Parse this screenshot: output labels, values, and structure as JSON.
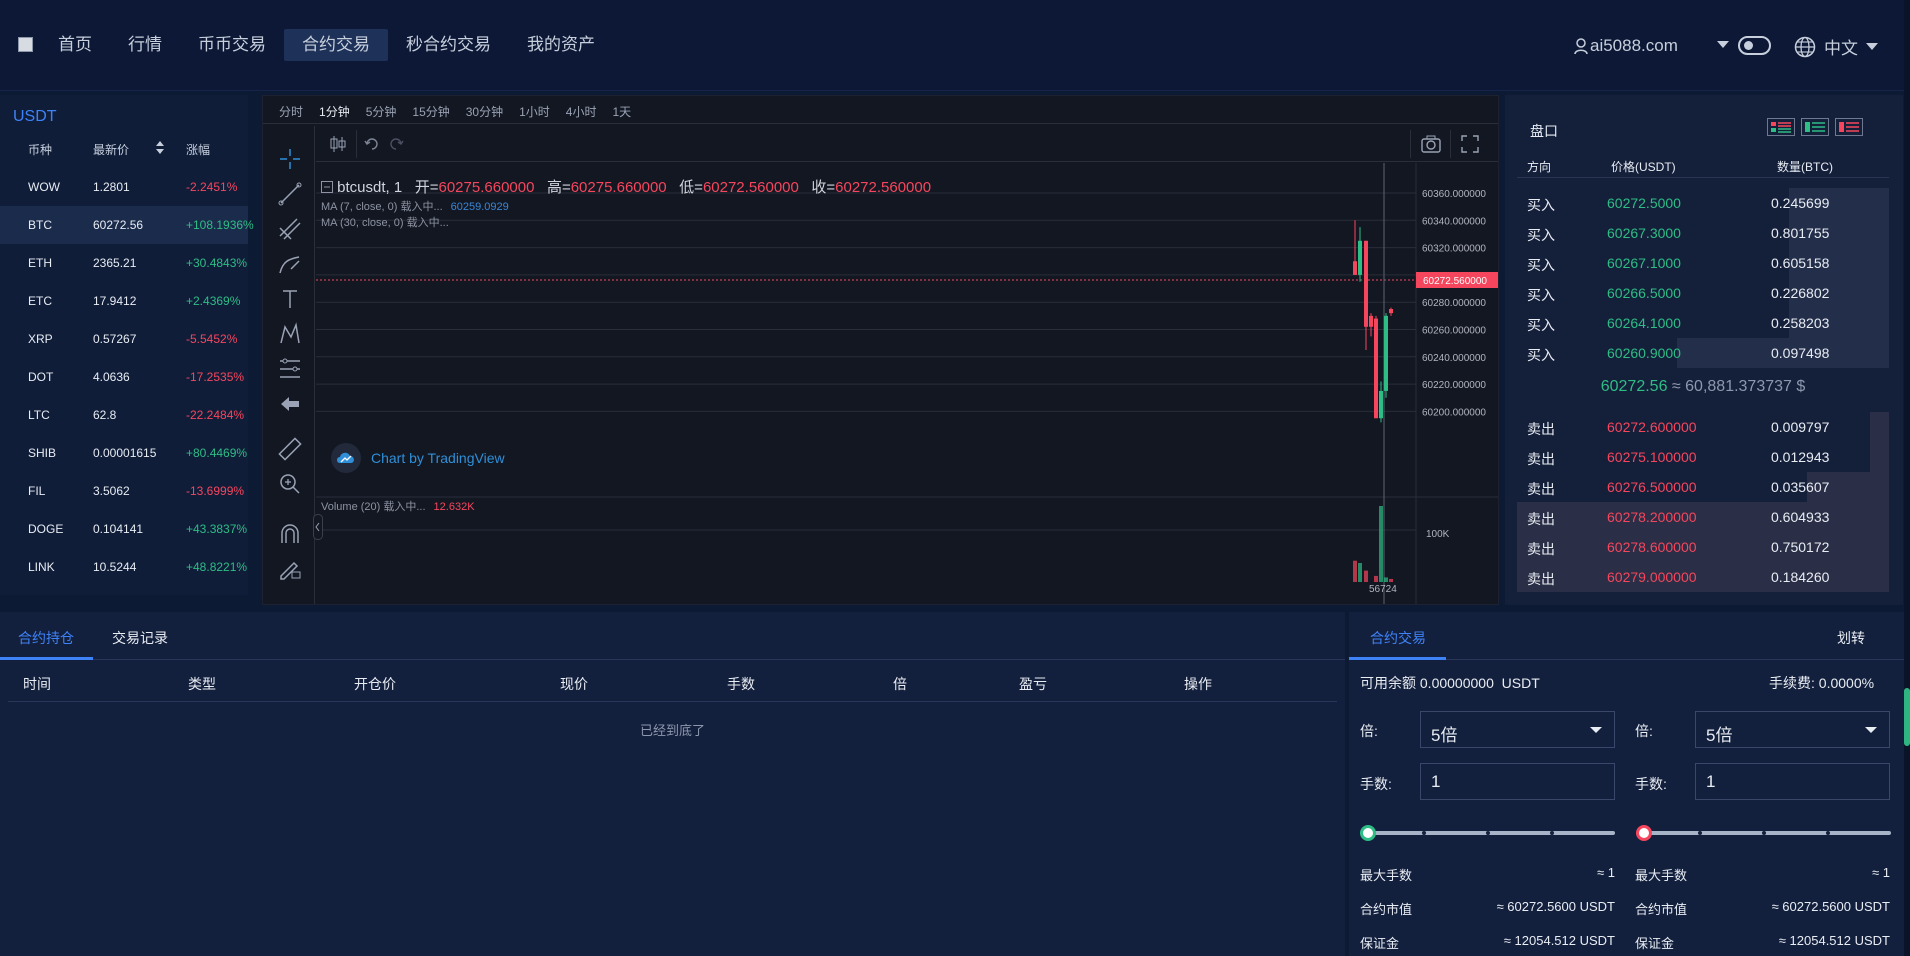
{
  "header": {
    "nav": [
      "首页",
      "行情",
      "币币交易",
      "合约交易",
      "秒合约交易",
      "我的资产"
    ],
    "active_nav": "合约交易",
    "user": "ai5088.com",
    "language": "中文"
  },
  "market": {
    "title": "USDT",
    "columns": [
      "币种",
      "最新价",
      "涨幅"
    ],
    "rows": [
      {
        "symbol": "WOW",
        "price": "1.2801",
        "change": "-2.2451%",
        "dir": "down"
      },
      {
        "symbol": "BTC",
        "price": "60272.56",
        "change": "+108.1936%",
        "dir": "up"
      },
      {
        "symbol": "ETH",
        "price": "2365.21",
        "change": "+30.4843%",
        "dir": "up"
      },
      {
        "symbol": "ETC",
        "price": "17.9412",
        "change": "+2.4369%",
        "dir": "up"
      },
      {
        "symbol": "XRP",
        "price": "0.57267",
        "change": "-5.5452%",
        "dir": "down"
      },
      {
        "symbol": "DOT",
        "price": "4.0636",
        "change": "-17.2535%",
        "dir": "down"
      },
      {
        "symbol": "LTC",
        "price": "62.8",
        "change": "-22.2484%",
        "dir": "down"
      },
      {
        "symbol": "SHIB",
        "price": "0.00001615",
        "change": "+80.4469%",
        "dir": "up"
      },
      {
        "symbol": "FIL",
        "price": "3.5062",
        "change": "-13.6999%",
        "dir": "down"
      },
      {
        "symbol": "DOGE",
        "price": "0.104141",
        "change": "+43.3837%",
        "dir": "up"
      },
      {
        "symbol": "LINK",
        "price": "10.5244",
        "change": "+48.8221%",
        "dir": "up"
      }
    ]
  },
  "chart": {
    "intervals": [
      "分时",
      "1分钟",
      "5分钟",
      "15分钟",
      "30分钟",
      "1小时",
      "4小时",
      "1天"
    ],
    "active_interval": "1分钟",
    "symbol": "btcusdt, 1",
    "ohlc": {
      "o_label": "开=",
      "o": "60275.660000",
      "h_label": "高=",
      "h": "60275.660000",
      "l_label": "低=",
      "l": "60272.560000",
      "c_label": "收=",
      "c": "60272.560000"
    },
    "ma7": {
      "label": "MA (7, close, 0) 载入中...",
      "value": "60259.0929"
    },
    "ma30": {
      "label": "MA (30, close, 0) 载入中..."
    },
    "volume": {
      "label": "Volume (20) 载入中...",
      "value": "12.632K"
    },
    "watermark": "Chart by TradingView",
    "price_axis": [
      "60360.000000",
      "60340.000000",
      "60320.000000",
      "60300.000000",
      "60280.000000",
      "60260.000000",
      "60240.000000",
      "60220.000000",
      "60200.000000"
    ],
    "last_price_tag": "60272.560000",
    "volume_axis": "100K",
    "time_label": "56724"
  },
  "orderbook": {
    "title": "盘口",
    "columns": [
      "方向",
      "价格(USDT)",
      "数量(BTC)"
    ],
    "bids": [
      {
        "dir": "买入",
        "price": "60272.5000",
        "qty": "0.245699",
        "depth": 0.27
      },
      {
        "dir": "买入",
        "price": "60267.3000",
        "qty": "0.801755",
        "depth": 0.27
      },
      {
        "dir": "买入",
        "price": "60267.1000",
        "qty": "0.605158",
        "depth": 0.27
      },
      {
        "dir": "买入",
        "price": "60266.5000",
        "qty": "0.226802",
        "depth": 0.27
      },
      {
        "dir": "买入",
        "price": "60264.1000",
        "qty": "0.258203",
        "depth": 0.27
      },
      {
        "dir": "买入",
        "price": "60260.9000",
        "qty": "0.097498",
        "depth": 0.57
      }
    ],
    "mid_price": "60272.56",
    "mid_usd": "≈ 60,881.373737 $",
    "asks": [
      {
        "dir": "卖出",
        "price": "60272.600000",
        "qty": "0.009797",
        "depth": 0.05
      },
      {
        "dir": "卖出",
        "price": "60275.100000",
        "qty": "0.012943",
        "depth": 0.05
      },
      {
        "dir": "卖出",
        "price": "60276.500000",
        "qty": "0.035607",
        "depth": 0.22
      },
      {
        "dir": "卖出",
        "price": "60278.200000",
        "qty": "0.604933",
        "depth": 1.0
      },
      {
        "dir": "卖出",
        "price": "60278.600000",
        "qty": "0.750172",
        "depth": 1.0
      },
      {
        "dir": "卖出",
        "price": "60279.000000",
        "qty": "0.184260",
        "depth": 1.0
      }
    ]
  },
  "positions": {
    "tabs": [
      "合约持仓",
      "交易记录"
    ],
    "columns": [
      "时间",
      "类型",
      "开仓价",
      "现价",
      "手数",
      "倍",
      "盈亏",
      "操作"
    ],
    "empty": "已经到底了"
  },
  "trade": {
    "tab": "合约交易",
    "transfer": "划转",
    "balance_label": "可用余额",
    "balance": "0.00000000",
    "balance_unit": "USDT",
    "fee_label": "手续费:",
    "fee": "0.0000%",
    "leverage_label": "倍:",
    "leverage": "5倍",
    "lots_label": "手数:",
    "lots": "1",
    "slider_value": 0,
    "max_lots_label": "最大手数",
    "max_lots": "≈ 1",
    "contract_value_label": "合约市值",
    "contract_value": "≈ 60272.5600 USDT",
    "margin_label": "保证金",
    "margin": "≈ 12054.512 USDT"
  },
  "colors": {
    "up": "#2ebd85",
    "down": "#f6465d",
    "accent": "#3e82f7"
  }
}
